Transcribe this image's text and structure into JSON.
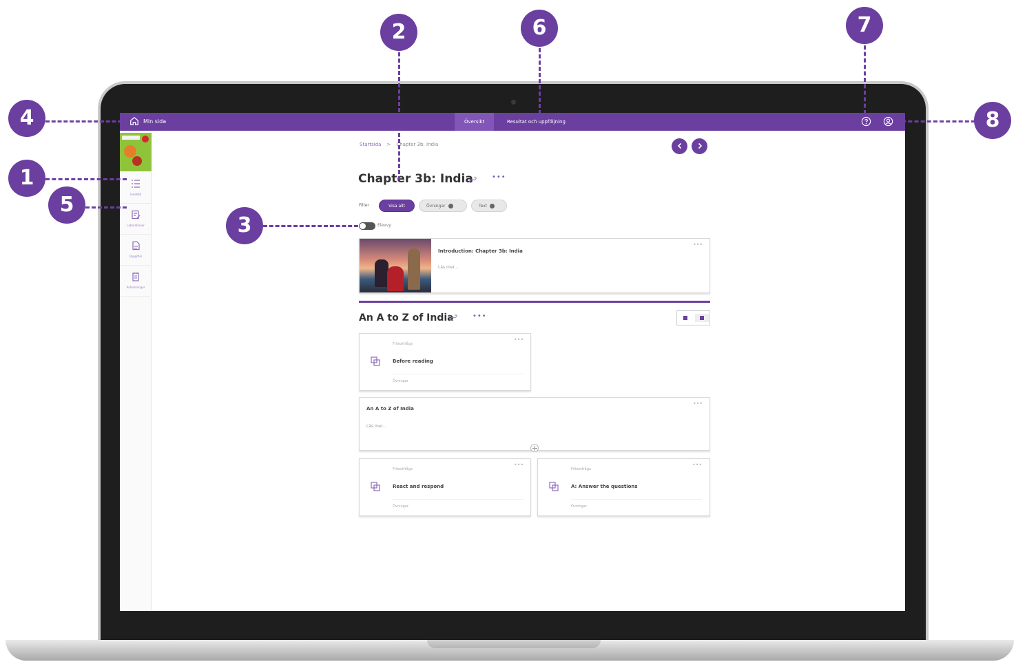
{
  "topbar": {
    "home_label": "Min sida",
    "tabs": [
      {
        "label": "Översikt",
        "active": true
      },
      {
        "label": "Resultat och uppföljning",
        "active": false
      }
    ]
  },
  "sidebar": {
    "items": [
      {
        "label": "Innehåll",
        "icon": "list-icon"
      },
      {
        "label": "Laborationer",
        "icon": "edit-note-icon"
      },
      {
        "label": "Uppgifter",
        "icon": "document-icon"
      },
      {
        "label": "Anteckningar",
        "icon": "notepad-icon"
      }
    ]
  },
  "breadcrumb": {
    "home": "Startsida",
    "separator": ">",
    "current": "Chapter 3b: India"
  },
  "chapter": {
    "title": "Chapter 3b: India"
  },
  "filter": {
    "label": "Filter",
    "chips": [
      {
        "label": "Visa allt",
        "active": true
      },
      {
        "label": "Övningar",
        "active": false
      },
      {
        "label": "Text",
        "active": false
      }
    ]
  },
  "elevvy": {
    "label": "Elevvy"
  },
  "intro": {
    "title": "Introduction: Chapter 3b: India",
    "read_more": "Läs mer..."
  },
  "section": {
    "title": "An A to Z of India"
  },
  "cards": {
    "before_reading": {
      "category": "Fritextfråga",
      "title": "Before reading",
      "footer": "Övningar"
    },
    "text_card": {
      "title": "An A to Z of India",
      "read_more": "Läs mer..."
    },
    "react_respond": {
      "category": "Fritextfråga",
      "title": "React and respond",
      "footer": "Övningar"
    },
    "answer_questions": {
      "category": "Fritextfråga",
      "title": "A: Answer the questions",
      "footer": "Övningar"
    }
  },
  "callouts": [
    "1",
    "2",
    "3",
    "4",
    "5",
    "6",
    "7",
    "8"
  ],
  "colors": {
    "accent": "#6b3fa0",
    "accent_light": "#8156b8"
  }
}
